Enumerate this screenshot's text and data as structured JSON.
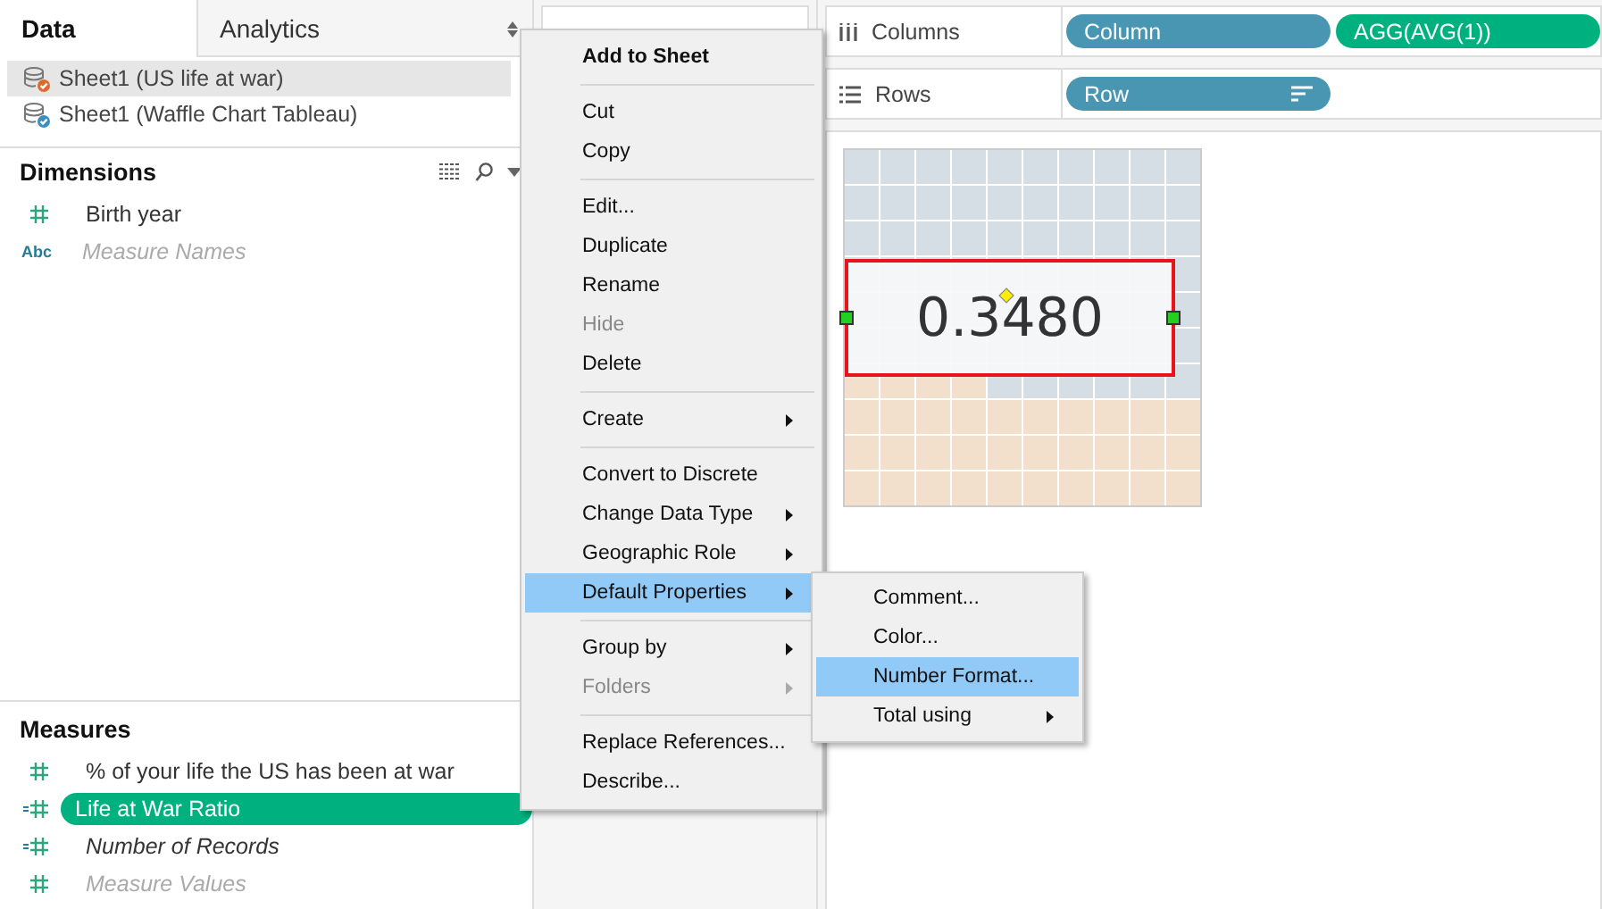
{
  "data_tabs": [
    {
      "label": "Data",
      "selected": true
    },
    {
      "label": "Analytics",
      "selected": false
    }
  ],
  "data_sources": [
    {
      "name": "Sheet1 (US life at war)",
      "kind": "primary",
      "selected": true
    },
    {
      "name": "Sheet1 (Waffle Chart Tableau)",
      "kind": "secondary",
      "selected": false
    }
  ],
  "dimensions": {
    "title": "Dimensions",
    "fields": [
      {
        "name": "Birth year",
        "kind": "number",
        "italic": false,
        "greyed": false,
        "selected": false
      },
      {
        "name": "Measure Names",
        "kind": "string",
        "icon_text": "Abc",
        "italic": true,
        "greyed": true,
        "selected": false
      }
    ]
  },
  "measures": {
    "title": "Measures",
    "fields": [
      {
        "name": "% of your life the US has been at war",
        "kind": "number",
        "italic": false,
        "greyed": false,
        "selected": false
      },
      {
        "name": "Life at War Ratio",
        "kind": "calculated",
        "italic": false,
        "greyed": false,
        "selected": true
      },
      {
        "name": "Number of Records",
        "kind": "calculated",
        "italic": true,
        "greyed": false,
        "selected": false
      },
      {
        "name": "Measure Values",
        "kind": "number",
        "italic": true,
        "greyed": true,
        "selected": false
      }
    ]
  },
  "shelves": [
    {
      "label": "Columns",
      "kind": "columns",
      "pills": [
        {
          "label": "Column",
          "color": "#4996b2",
          "sorted": false
        },
        {
          "label": "AGG(AVG(1))",
          "color": "#00b180",
          "sorted": false
        }
      ]
    },
    {
      "label": "Rows",
      "kind": "rows",
      "pills": [
        {
          "label": "Row",
          "color": "#4996b2",
          "sorted": true
        }
      ]
    }
  ],
  "view": {
    "label_value": "0.3480"
  },
  "context_menu": {
    "items": [
      {
        "kind": "item",
        "label": "Add to Sheet",
        "bold": true,
        "disabled": false,
        "submenu": false,
        "selected": false
      },
      {
        "kind": "separator"
      },
      {
        "kind": "item",
        "label": "Cut",
        "bold": false,
        "disabled": false,
        "submenu": false,
        "selected": false
      },
      {
        "kind": "item",
        "label": "Copy",
        "bold": false,
        "disabled": false,
        "submenu": false,
        "selected": false
      },
      {
        "kind": "separator"
      },
      {
        "kind": "item",
        "label": "Edit...",
        "bold": false,
        "disabled": false,
        "submenu": false,
        "selected": false
      },
      {
        "kind": "item",
        "label": "Duplicate",
        "bold": false,
        "disabled": false,
        "submenu": false,
        "selected": false
      },
      {
        "kind": "item",
        "label": "Rename",
        "bold": false,
        "disabled": false,
        "submenu": false,
        "selected": false
      },
      {
        "kind": "item",
        "label": "Hide",
        "bold": false,
        "disabled": true,
        "submenu": false,
        "selected": false
      },
      {
        "kind": "item",
        "label": "Delete",
        "bold": false,
        "disabled": false,
        "submenu": false,
        "selected": false
      },
      {
        "kind": "separator"
      },
      {
        "kind": "item",
        "label": "Create",
        "bold": false,
        "disabled": false,
        "submenu": true,
        "selected": false
      },
      {
        "kind": "separator"
      },
      {
        "kind": "item",
        "label": "Convert to Discrete",
        "bold": false,
        "disabled": false,
        "submenu": false,
        "selected": false
      },
      {
        "kind": "item",
        "label": "Change Data Type",
        "bold": false,
        "disabled": false,
        "submenu": true,
        "selected": false
      },
      {
        "kind": "item",
        "label": "Geographic Role",
        "bold": false,
        "disabled": false,
        "submenu": true,
        "selected": false
      },
      {
        "kind": "item",
        "label": "Default Properties",
        "bold": false,
        "disabled": false,
        "submenu": true,
        "selected": true
      },
      {
        "kind": "separator"
      },
      {
        "kind": "item",
        "label": "Group by",
        "bold": false,
        "disabled": false,
        "submenu": true,
        "selected": false
      },
      {
        "kind": "item",
        "label": "Folders",
        "bold": false,
        "disabled": true,
        "submenu": true,
        "selected": false
      },
      {
        "kind": "separator"
      },
      {
        "kind": "item",
        "label": "Replace References...",
        "bold": false,
        "disabled": false,
        "submenu": false,
        "selected": false
      },
      {
        "kind": "item",
        "label": "Describe...",
        "bold": false,
        "disabled": false,
        "submenu": false,
        "selected": false
      }
    ]
  },
  "submenu": {
    "items": [
      {
        "label": "Comment...",
        "submenu": false,
        "selected": false
      },
      {
        "label": "Color...",
        "submenu": false,
        "selected": false
      },
      {
        "label": "Number Format...",
        "submenu": false,
        "selected": true
      },
      {
        "label": "Total using",
        "submenu": true,
        "selected": false
      }
    ]
  }
}
